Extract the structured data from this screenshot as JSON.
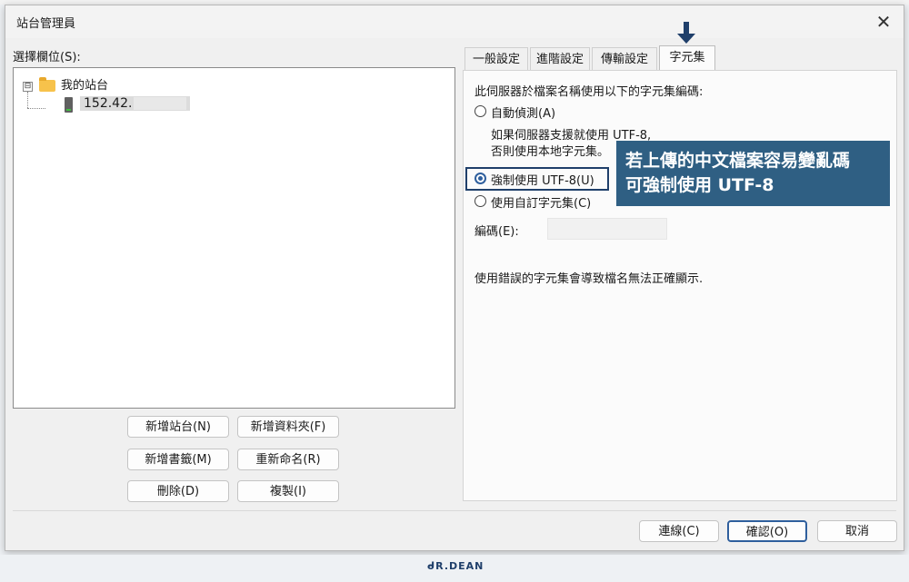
{
  "dialog": {
    "title": "站台管理員",
    "close_icon": "close-icon",
    "select_label": "選擇欄位(S):"
  },
  "tree": {
    "root_label": "我的站台",
    "host_label": "152.42.",
    "expander": "⊟"
  },
  "buttons": {
    "new_site": "新增站台(N)",
    "new_folder": "新增資料夾(F)",
    "new_bookmark": "新增書籤(M)",
    "rename": "重新命名(R)",
    "delete": "刪除(D)",
    "duplicate": "複製(I)"
  },
  "tabs": [
    "一般設定",
    "進階設定",
    "傳輸設定",
    "字元集"
  ],
  "charset_panel": {
    "heading": "此伺服器於檔案名稱使用以下的字元集編碼:",
    "option_auto": "自動偵測(A)",
    "auto_desc_line1": "如果伺服器支援就使用 UTF-8,",
    "auto_desc_line2": "否則使用本地字元集。",
    "option_utf8": "強制使用 UTF-8(U)",
    "option_custom": "使用自訂字元集(C)",
    "encoding_label": "編碼(E):",
    "warning": "使用錯誤的字元集會導致檔名無法正確顯示."
  },
  "callout": {
    "line1": "若上傳的中文檔案容易變亂碼",
    "line2": "可強制使用 UTF-8"
  },
  "footer_buttons": {
    "connect": "連線(C)",
    "ok": "確認(O)",
    "cancel": "取消"
  },
  "logo": "ᑯR.DEAN",
  "colors": {
    "accent": "#2f5f83",
    "highlight": "#1f3f6a"
  }
}
